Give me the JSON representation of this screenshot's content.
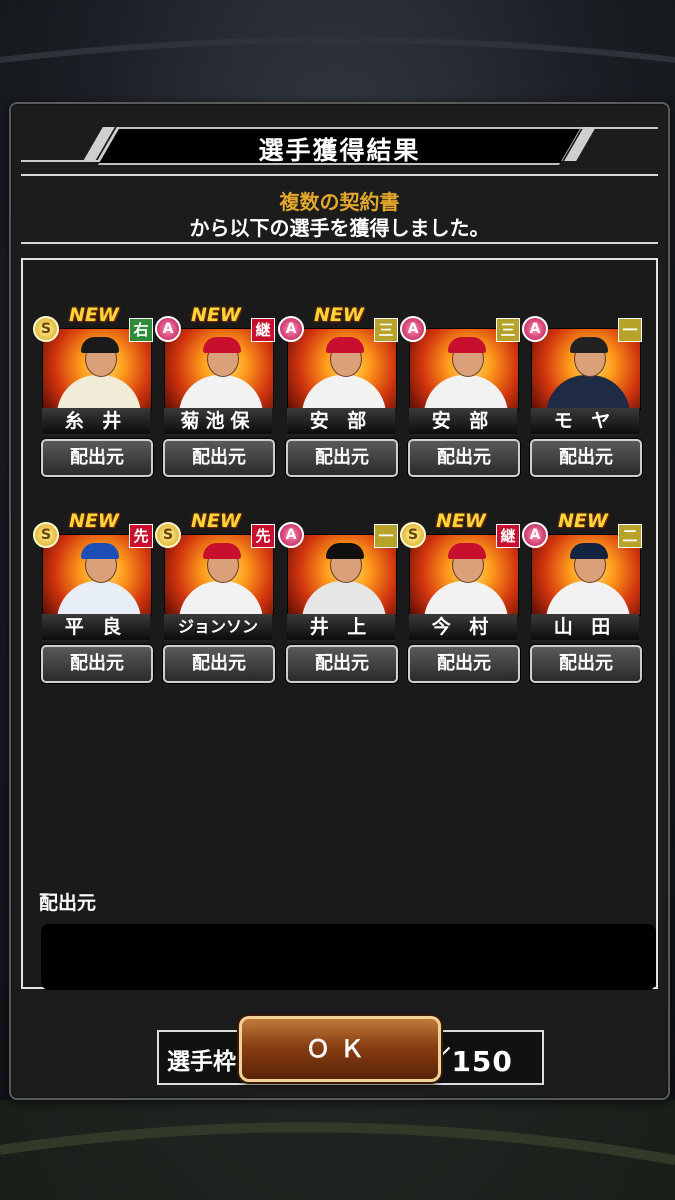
{
  "dialog": {
    "title": "選手獲得結果",
    "message_gold": "複数の契約書",
    "message_white": "から以下の選手を獲得しました。"
  },
  "players": [
    {
      "name": "糸 井",
      "rank": "S",
      "position": "右",
      "position_color": "green",
      "new": true,
      "button": "配出元",
      "cap_color": "#1a1a1a",
      "uniform_color": "#f0ecd8"
    },
    {
      "name": "菊池保",
      "rank": "A",
      "position": "継",
      "position_color": "red",
      "new": true,
      "button": "配出元",
      "cap_color": "#c8102e",
      "uniform_color": "#f2f2f2"
    },
    {
      "name": "安 部",
      "rank": "A",
      "position": "三",
      "position_color": "yellow",
      "new": true,
      "button": "配出元",
      "cap_color": "#c8102e",
      "uniform_color": "#f2f2f2"
    },
    {
      "name": "安 部",
      "rank": "A",
      "position": "三",
      "position_color": "yellow",
      "new": false,
      "button": "配出元",
      "cap_color": "#c8102e",
      "uniform_color": "#f2f2f2"
    },
    {
      "name": "モ ヤ",
      "rank": "A",
      "position": "一",
      "position_color": "yellow",
      "new": false,
      "button": "配出元",
      "cap_color": "#222222",
      "uniform_color": "#1f2a44"
    },
    {
      "name": "平 良",
      "rank": "S",
      "position": "先",
      "position_color": "red",
      "new": true,
      "button": "配出元",
      "cap_color": "#1d4fb8",
      "uniform_color": "#e8eef8"
    },
    {
      "name": "ジョンソン",
      "rank": "S",
      "position": "先",
      "position_color": "red",
      "new": true,
      "button": "配出元",
      "cap_color": "#c8102e",
      "uniform_color": "#f2f2f2"
    },
    {
      "name": "井 上",
      "rank": "A",
      "position": "一",
      "position_color": "yellow",
      "new": false,
      "button": "配出元",
      "cap_color": "#111111",
      "uniform_color": "#e6e6e6"
    },
    {
      "name": "今 村",
      "rank": "S",
      "position": "継",
      "position_color": "red",
      "new": true,
      "button": "配出元",
      "cap_color": "#c8102e",
      "uniform_color": "#f2f2f2"
    },
    {
      "name": "山 田",
      "rank": "A",
      "position": "二",
      "position_color": "yellow",
      "new": true,
      "button": "配出元",
      "cap_color": "#14233f",
      "uniform_color": "#f2f2f2"
    }
  ],
  "new_label": "NEW",
  "source": {
    "label": "配出元",
    "value": ""
  },
  "roster": {
    "label": "選手枠：",
    "value": "125／150"
  },
  "ok_label": "ＯＫ"
}
